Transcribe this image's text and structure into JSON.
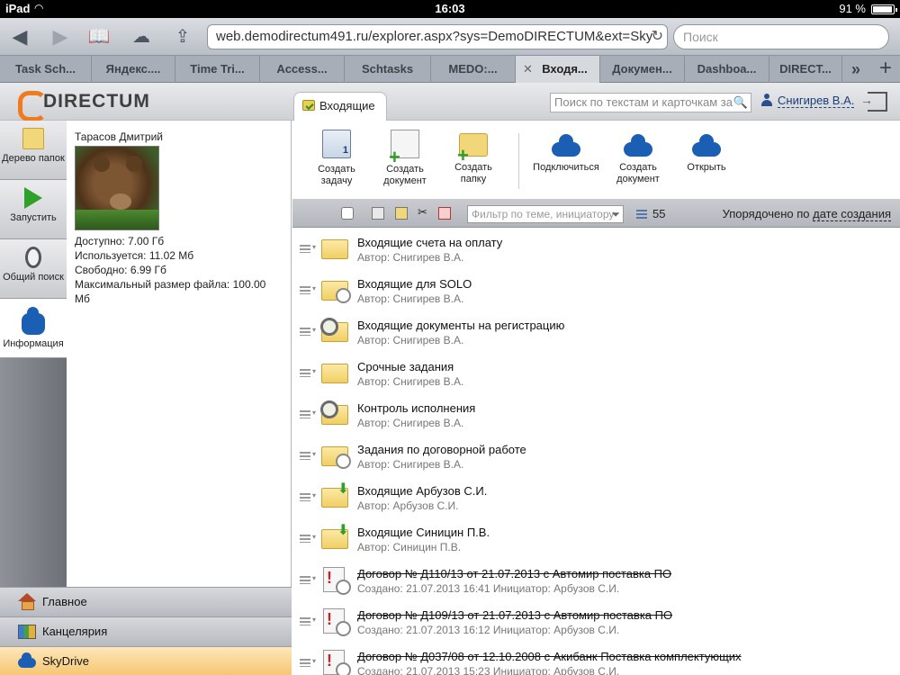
{
  "status_bar": {
    "carrier": "iPad",
    "time": "16:03",
    "battery": "91 %"
  },
  "browser": {
    "url": "web.demodirectum491.ru/explorer.aspx?sys=DemoDIRECTUM&ext=Sky",
    "search_placeholder": "Поиск",
    "tabs": [
      {
        "label": "Task Sch..."
      },
      {
        "label": "Яндекс...."
      },
      {
        "label": "Time Tri..."
      },
      {
        "label": "Access..."
      },
      {
        "label": "Schtasks"
      },
      {
        "label": "MEDO:..."
      },
      {
        "label": "Входя..."
      },
      {
        "label": "Докумен..."
      },
      {
        "label": "Dashboa..."
      },
      {
        "label": "DIRECT..."
      }
    ]
  },
  "app": {
    "logo": "DIRECTUM",
    "active_tab": "Входящие",
    "search_placeholder": "Поиск по текстам и карточкам за",
    "user": "Снигирев В.А."
  },
  "left_nav": [
    {
      "label": "Дерево папок",
      "icon": "folder-icon"
    },
    {
      "label": "Запустить",
      "icon": "play-icon"
    },
    {
      "label": "Общий поиск",
      "icon": "magnifier-icon"
    },
    {
      "label": "Информация",
      "icon": "skydrive-icon"
    }
  ],
  "info": {
    "owner": "Тарасов Дмитрий",
    "available": "Доступно: 7.00 Гб",
    "used": "Используется: 11.02 Мб",
    "free": "Свободно: 6.99 Гб",
    "max_file": "Максимальный размер файла: 100.00 Мб"
  },
  "bottom_nav": [
    {
      "label": "Главное",
      "icon": "home-icon"
    },
    {
      "label": "Канцелярия",
      "icon": "binders-icon"
    },
    {
      "label": "SkyDrive",
      "icon": "skydrive-icon"
    }
  ],
  "actions": [
    {
      "label": "Создать задачу"
    },
    {
      "label": "Создать документ"
    },
    {
      "label": "Создать папку"
    },
    {
      "label": "Подключиться"
    },
    {
      "label": "Создать документ"
    },
    {
      "label": "Открыть"
    }
  ],
  "list_toolbar": {
    "filter_placeholder": "Фильтр по теме, инициатору",
    "count": "55",
    "sort_prefix": "Упорядочено по",
    "sort_field": "дате создания"
  },
  "items": [
    {
      "title": "Входящие счета на оплату",
      "sub": "Автор: Снигирев В.А.",
      "icon": "folder-icon"
    },
    {
      "title": "Входящие для SOLO",
      "sub": "Автор: Снигирев В.А.",
      "icon": "folder-clock-icon"
    },
    {
      "title": "Входящие документы на регистрацию",
      "sub": "Автор: Снигирев В.А.",
      "icon": "folder-search-icon"
    },
    {
      "title": "Срочные задания",
      "sub": "Автор: Снигирев В.А.",
      "icon": "folder-icon"
    },
    {
      "title": "Контроль исполнения",
      "sub": "Автор: Снигирев В.А.",
      "icon": "folder-search-icon"
    },
    {
      "title": "Задания по договорной работе",
      "sub": "Автор: Снигирев В.А.",
      "icon": "folder-clock-icon"
    },
    {
      "title": "Входящие Арбузов С.И.",
      "sub": "Автор: Арбузов С.И.",
      "icon": "folder-incoming-icon"
    },
    {
      "title": "Входящие Синицин П.В.",
      "sub": "Автор: Синицин П.В.",
      "icon": "folder-incoming-icon"
    },
    {
      "title": "Договор № Д110/13 от 21.07.2013 с Автомир поставка ПО",
      "sub": "Создано: 21.07.2013 16:41   Инициатор: Арбузов С.И.",
      "icon": "overdue-task-icon"
    },
    {
      "title": "Договор № Д109/13 от 21.07.2013 с Автомир поставка ПО",
      "sub": "Создано: 21.07.2013 16:12   Инициатор: Арбузов С.И.",
      "icon": "overdue-task-icon"
    },
    {
      "title": "Договор № Д037/08 от 12.10.2008 с Акибанк Поставка комплектующих",
      "sub": "Создано: 21.07.2013 15:23   Инициатор: Арбузов С.И.",
      "icon": "overdue-task-icon"
    }
  ]
}
